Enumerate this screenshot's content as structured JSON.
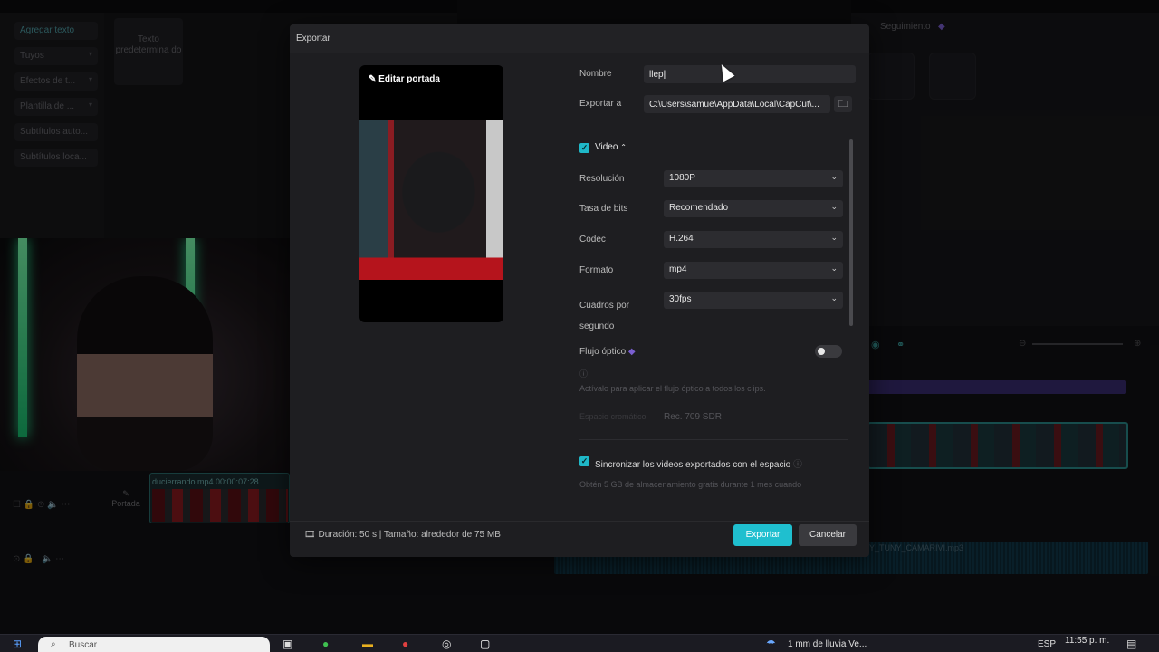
{
  "app": {
    "left_panel_items": [
      "Agregar texto",
      "Tuyos",
      "Efectos de t...",
      "Plantilla de ...",
      "Subtítulos auto...",
      "Subtítulos loca..."
    ],
    "texto_card": "Texto predetermina do",
    "right_panel_label": "Seguimiento",
    "timeline_clip_label": "ducierrando.mp4  00:00:07:28",
    "portada_label": "Portada",
    "audio_label": "Y_TUNY_CAMARIVI.mp3"
  },
  "dialog": {
    "title": "Exportar",
    "cover_edit_label": "Editar portada",
    "name_label": "Nombre",
    "name_value": "llep",
    "export_to_label": "Exportar a",
    "export_path": "C:\\Users\\samue\\AppData\\Local\\CapCut\\...",
    "video_section_label": "Video",
    "settings": [
      {
        "label": "Resolución",
        "value": "1080P"
      },
      {
        "label": "Tasa de bits",
        "value": "Recomendado"
      },
      {
        "label": "Codec",
        "value": "H.264"
      },
      {
        "label": "Formato",
        "value": "mp4"
      },
      {
        "label": "Cuadros por segundo",
        "value": "30fps"
      }
    ],
    "optical_flow_label": "Flujo óptico",
    "optical_flow_hint": "Actívalo para aplicar el flujo óptico a todos los clips.",
    "color_space_label": "Espacio cromático",
    "color_space_value": "Rec. 709 SDR",
    "sync_label": "Sincronizar los videos exportados con el espacio",
    "sync_hint": "Obtén 5 GB de almacenamiento gratis durante 1 mes cuando",
    "footer_info": "Duración: 50 s | Tamaño: alrededor de 75 MB",
    "export_button": "Exportar",
    "cancel_button": "Cancelar"
  },
  "taskbar": {
    "search_placeholder": "Buscar",
    "weather_text": "1 mm de lluvia Ve...",
    "language": "ESP",
    "time": "11:55 p. m."
  },
  "colors": {
    "accent": "#1fbfcf",
    "dialog_bg": "#1e1e21",
    "premium_diamond": "#7a5fd0"
  }
}
